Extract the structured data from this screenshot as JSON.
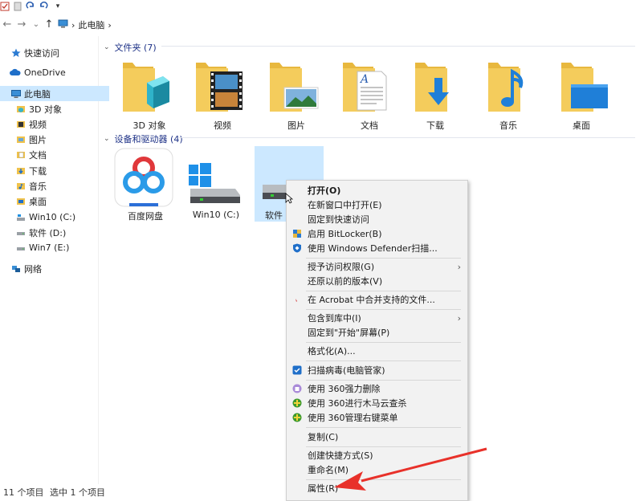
{
  "quick_access_toolbar": {
    "dropdown_glyph": "▾"
  },
  "address": {
    "back_glyph": "←",
    "forward_glyph": "→",
    "recent_glyph": "⌄",
    "up_glyph": "↑",
    "sep_glyph": "›",
    "path": [
      "此电脑"
    ]
  },
  "sidebar": {
    "items": [
      {
        "label": "快速访问",
        "icon": "star-icon"
      },
      {
        "label": "OneDrive",
        "icon": "cloud-icon"
      },
      {
        "label": "此电脑",
        "icon": "computer-icon",
        "selected": true
      },
      {
        "label": "3D 对象",
        "icon": "3d-objects-icon"
      },
      {
        "label": "视频",
        "icon": "video-icon"
      },
      {
        "label": "图片",
        "icon": "pictures-icon"
      },
      {
        "label": "文档",
        "icon": "documents-icon"
      },
      {
        "label": "下载",
        "icon": "downloads-icon"
      },
      {
        "label": "音乐",
        "icon": "music-icon"
      },
      {
        "label": "桌面",
        "icon": "desktop-icon"
      },
      {
        "label": "Win10 (C:)",
        "icon": "drive-icon"
      },
      {
        "label": "软件 (D:)",
        "icon": "drive-icon"
      },
      {
        "label": "Win7 (E:)",
        "icon": "drive-icon"
      },
      {
        "label": "网络",
        "icon": "network-icon"
      }
    ]
  },
  "folders_group": {
    "title": "文件夹 (7)",
    "chevron": "⌄",
    "items": [
      {
        "label": "3D 对象",
        "icon": "3d-objects-folder-icon"
      },
      {
        "label": "视频",
        "icon": "video-folder-icon"
      },
      {
        "label": "图片",
        "icon": "pictures-folder-icon"
      },
      {
        "label": "文档",
        "icon": "documents-folder-icon"
      },
      {
        "label": "下载",
        "icon": "downloads-folder-icon"
      },
      {
        "label": "音乐",
        "icon": "music-folder-icon"
      },
      {
        "label": "桌面",
        "icon": "desktop-folder-icon"
      }
    ]
  },
  "drives_group": {
    "title": "设备和驱动器 (4)",
    "chevron": "⌄",
    "items": [
      {
        "label": "百度网盘",
        "icon": "baidu-netdisk-icon"
      },
      {
        "label": "Win10 (C:)",
        "icon": "windows-drive-icon"
      },
      {
        "label": "软件",
        "icon": "drive-icon",
        "selected": true
      }
    ]
  },
  "context_menu": {
    "submenu_glyph": "›",
    "items": [
      {
        "label": "打开(O)",
        "bold": true
      },
      {
        "label": "在新窗口中打开(E)"
      },
      {
        "label": "固定到快速访问"
      },
      {
        "label": "启用 BitLocker(B)",
        "icon": "shield-icon"
      },
      {
        "label": "使用 Windows Defender扫描...",
        "icon": "defender-icon"
      },
      {
        "label": "授予访问权限(G)",
        "submenu": true
      },
      {
        "label": "还原以前的版本(V)"
      },
      {
        "label": "在 Acrobat 中合并支持的文件...",
        "icon": "acrobat-icon"
      },
      {
        "label": "包含到库中(I)",
        "submenu": true
      },
      {
        "label": "固定到\"开始\"屏幕(P)"
      },
      {
        "label": "格式化(A)..."
      },
      {
        "label": "扫描病毒(电脑管家)",
        "icon": "tencent-pc-manager-icon"
      },
      {
        "label": "使用 360强力删除",
        "icon": "360-delete-icon"
      },
      {
        "label": "使用 360进行木马云查杀",
        "icon": "360-scan-icon"
      },
      {
        "label": "使用 360管理右键菜单",
        "icon": "360-menu-icon"
      },
      {
        "label": "复制(C)"
      },
      {
        "label": "创建快捷方式(S)"
      },
      {
        "label": "重命名(M)"
      },
      {
        "label": "属性(R)"
      }
    ]
  },
  "status_bar": {
    "item_count": "11 个项目",
    "selected": "选中 1 个项目"
  },
  "colors": {
    "selection": "#cce8ff",
    "drive_selected": "#cce8ff",
    "folder_yellow": "#f0c24b",
    "header_blue": "#1e3287",
    "annotation_arrow": "#e8312a"
  }
}
